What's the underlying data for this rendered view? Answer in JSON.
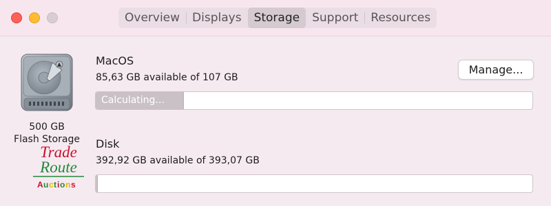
{
  "window": {
    "tabs": [
      {
        "label": "Overview",
        "active": false
      },
      {
        "label": "Displays",
        "active": false
      },
      {
        "label": "Storage",
        "active": true
      },
      {
        "label": "Support",
        "active": false
      },
      {
        "label": "Resources",
        "active": false
      }
    ]
  },
  "drive": {
    "icon": "hard-drive-icon",
    "capacity": "500 GB",
    "type": "Flash Storage"
  },
  "watermark": {
    "line1": "Trade",
    "line2": "Route",
    "line3": "Auctions"
  },
  "volumes": [
    {
      "name": "MacOS",
      "available": "85,63 GB available of 107 GB",
      "bar_label": "Calculating...",
      "bar_fill_fraction": 0.2
    },
    {
      "name": "Disk",
      "available": "392,92 GB available of 393,07 GB",
      "bar_fill_fraction": 0.003
    }
  ],
  "actions": {
    "manage_label": "Manage..."
  },
  "colors": {
    "close": "#fe5f57",
    "minimize": "#febc2e",
    "zoom": "#d8cdd3",
    "bar_fill": "#c9c1c6",
    "watermark_red": "#c8102e",
    "watermark_green": "#1e8a3a"
  }
}
